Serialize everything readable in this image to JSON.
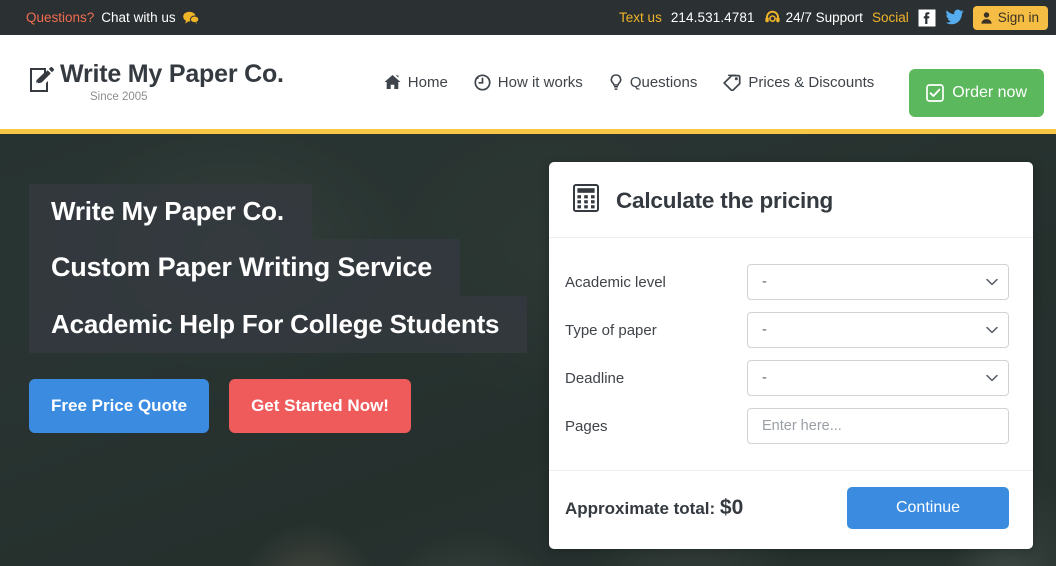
{
  "topbar": {
    "questions_label": "Questions?",
    "chat_label": "Chat with us",
    "chat_icon": "chat-bubble-icon",
    "text_us_label": "Text us",
    "phone": "214.531.4781",
    "support_label": "24/7 Support",
    "support_icon": "headset-icon",
    "social_label": "Social",
    "facebook_icon": "facebook-icon",
    "twitter_icon": "twitter-icon",
    "signin_label": "Sign in",
    "signin_icon": "user-icon",
    "colors": {
      "bar_bg": "#2b3033",
      "questions": "#f26c4f",
      "accent_yellow": "#f0b429",
      "signin_bg": "#f5bd43"
    }
  },
  "header": {
    "logo_icon": "pencil-document-icon",
    "logo_title": "Write My Paper Co.",
    "logo_subtitle": "Since 2005",
    "nav": [
      {
        "label": "Home",
        "icon": "home-icon"
      },
      {
        "label": "How it works",
        "icon": "clock-rewind-icon"
      },
      {
        "label": "Questions",
        "icon": "lightbulb-icon"
      },
      {
        "label": "Prices & Discounts",
        "icon": "price-tag-icon"
      }
    ],
    "order_label": "Order now",
    "order_icon": "checkbox-checked-icon",
    "order_color": "#5cb85c",
    "rule_color": "#f7c644"
  },
  "hero": {
    "headline_1": "Write My Paper Co.",
    "headline_2": "Custom Paper Writing Service",
    "headline_3": "Academic Help For College Students",
    "cta_primary": "Free Price Quote",
    "cta_secondary": "Get Started Now!",
    "cta_primary_color": "#3b8ce0",
    "cta_secondary_color": "#ef5b5b"
  },
  "calculator": {
    "title": "Calculate the pricing",
    "title_icon": "calculator-icon",
    "fields": [
      {
        "label": "Academic level",
        "type": "select",
        "value": "-"
      },
      {
        "label": "Type of paper",
        "type": "select",
        "value": "-"
      },
      {
        "label": "Deadline",
        "type": "select",
        "value": "-"
      },
      {
        "label": "Pages",
        "type": "text",
        "value": "",
        "placeholder": "Enter here..."
      }
    ],
    "total_label": "Approximate total:",
    "total_value": "$0",
    "continue_label": "Continue",
    "continue_color": "#3b8ce0"
  }
}
